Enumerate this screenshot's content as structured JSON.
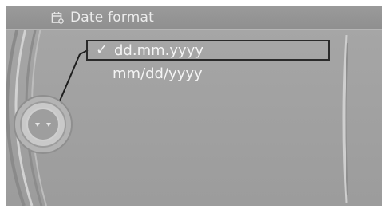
{
  "title": {
    "icon": "calendar-settings-icon",
    "text": "Date format"
  },
  "menu": {
    "items": [
      {
        "label": "dd.mm.yyyy",
        "selected": true,
        "checkmark": "✓"
      },
      {
        "label": "mm/dd/yyyy",
        "selected": false,
        "checkmark": ""
      }
    ]
  },
  "controller": {
    "icon": "idrive-controller-icon"
  },
  "colors": {
    "background": "#a4a4a4",
    "title_bar": "#939393",
    "text": "#f4f4f4",
    "selection_border": "#2a2a2a"
  }
}
